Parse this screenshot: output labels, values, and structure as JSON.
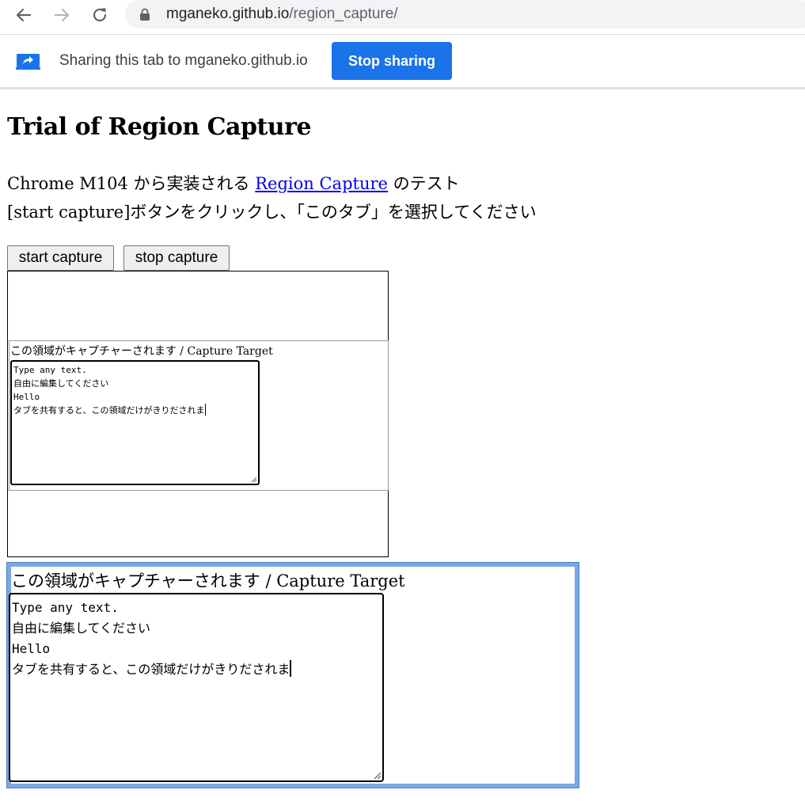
{
  "browser": {
    "url_host": "mganeko.github.io",
    "url_path": "/region_capture/"
  },
  "infobar": {
    "message": "Sharing this tab to mganeko.github.io",
    "stop_label": "Stop sharing"
  },
  "page": {
    "title": "Trial of Region Capture",
    "desc_line1_prefix": "Chrome M104 から実装される ",
    "desc_line1_link": "Region Capture",
    "desc_line1_suffix": " のテスト",
    "desc_line2": "[start capture]ボタンをクリックし、「このタブ」を選択してください",
    "start_label": "start capture",
    "stop_label": "stop capture"
  },
  "preview": {
    "label": "この領域がキャプチャーされます / Capture Target",
    "text": "Type any text.\n自由に編集してください\nHello\nタブを共有すると、この領域だけがきりだされま"
  },
  "capture_target": {
    "label": "この領域がキャプチャーされます / Capture Target",
    "text": "Type any text.\n自由に編集してください\nHello\nタブを共有すると、この領域だけがきりだされま"
  },
  "colors": {
    "accent": "#1a73e8",
    "capture_border": "#7ba7e3",
    "link": "#0000ee"
  }
}
